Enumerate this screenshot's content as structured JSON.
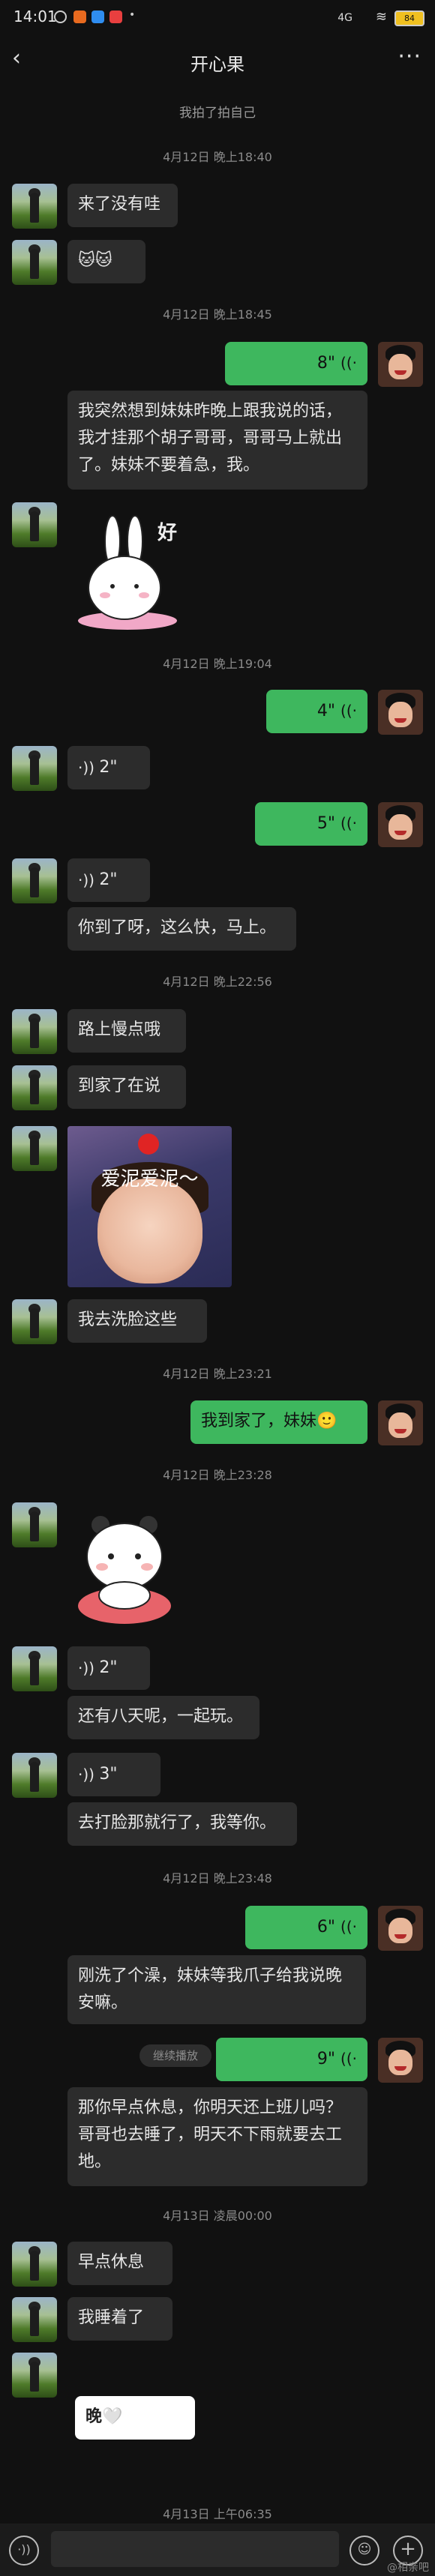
{
  "status_bar": {
    "time": "14:01",
    "signal": "4G",
    "battery": "84"
  },
  "header": {
    "title": "开心果",
    "back_icon": "chevron-left-icon",
    "more_icon": "more-icon"
  },
  "system_note": "我拍了拍自己",
  "timestamps": {
    "t1": "4月12日 晚上18:40",
    "t2": "4月12日 晚上18:45",
    "t3": "4月12日 晚上19:04",
    "t4": "4月12日 晚上22:56",
    "t5": "4月12日 晚上23:21",
    "t6": "4月12日 晚上23:28",
    "t7": "4月12日 晚上23:48",
    "t8": "4月13日 凌晨00:00",
    "t9": "4月13日 上午06:35"
  },
  "messages": {
    "m1": "来了没有哇",
    "m2": "🐱🐱",
    "v1": "8\"",
    "m3": "我突然想到妹妹昨晚上跟我说的话，我才挂那个胡子哥哥，哥哥马上就出了。妹妹不要着急，我。",
    "sticker1_text": "好",
    "v2": "4\"",
    "v3": "2\"",
    "v4": "5\"",
    "v5": "2\"",
    "m4": "你到了呀，这么快，马上。",
    "m5": "路上慢点哦",
    "m6": "到家了在说",
    "photo_caption": "爱泥爱泥～",
    "m7": "我去洗脸这些",
    "m8": "我到家了，妹妹🙂",
    "v6": "2\"",
    "m9": "还有八天呢，一起玩。",
    "v7": "3\"",
    "m10": "去打脸那就行了，我等你。",
    "v8": "6\"",
    "m11": "刚洗了个澡，妹妹等我爪子给我说晚安嘛。",
    "replay": "继续播放",
    "v9": "9\"",
    "m12": "那你早点休息，你明天还上班儿吗？哥哥也去睡了，明天不下雨就要去工地。",
    "m13": "早点休息",
    "m14": "我睡着了",
    "m15": "晚🤍"
  },
  "watermark": "@相亲吧",
  "colors": {
    "background": "#111111",
    "bubble_other": "#2c2c2c",
    "bubble_me": "#3eb75e"
  }
}
